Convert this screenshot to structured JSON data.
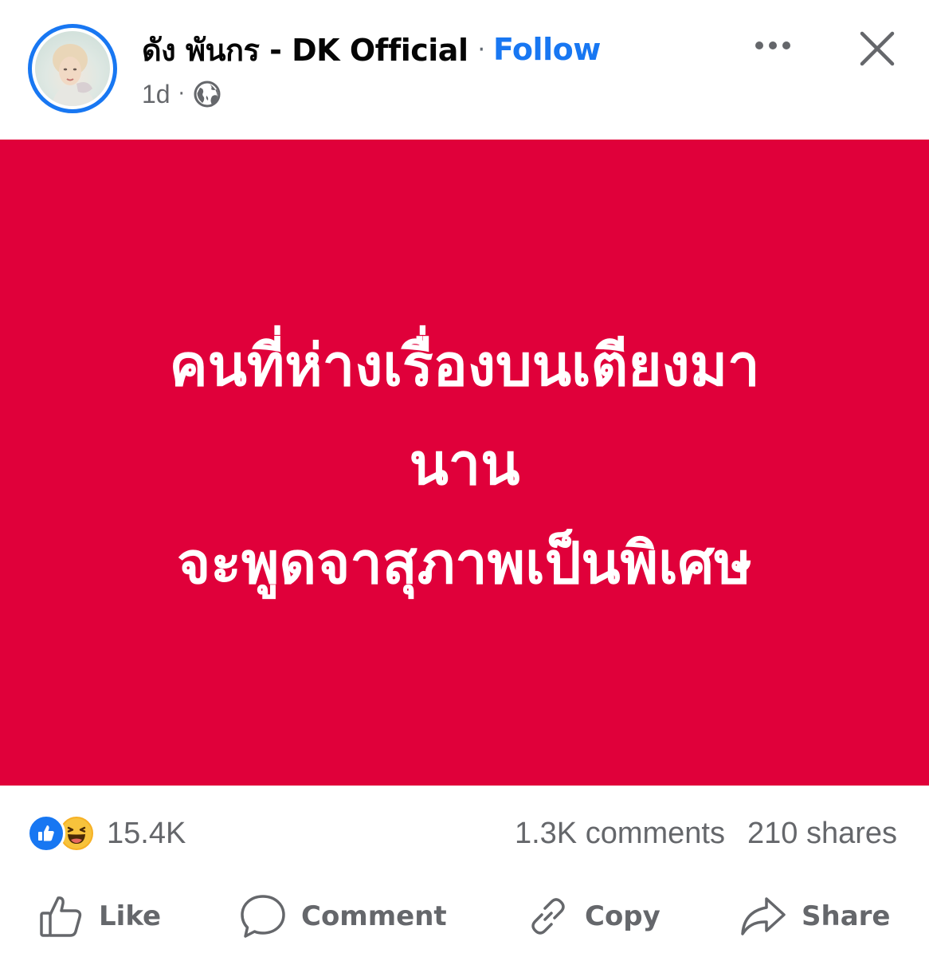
{
  "header": {
    "author_name": "ดัง พันกร - DK Official",
    "separator": "·",
    "follow_label": "Follow",
    "time": "1d",
    "time_separator": "·",
    "privacy_icon": "globe-icon",
    "more_icon": "ellipsis-icon",
    "close_icon": "close-icon"
  },
  "post": {
    "background_color": "#e0003a",
    "text_color": "#ffffff",
    "lines": [
      "คนที่ห่างเรื่องบนเตียงมา",
      "นาน",
      "จะพูดจาสุภาพเป็นพิเศษ"
    ]
  },
  "stats": {
    "reactions": [
      "like",
      "haha"
    ],
    "reaction_count": "15.4K",
    "comments": "1.3K comments",
    "shares": "210 shares"
  },
  "actions": {
    "like_label": "Like",
    "comment_label": "Comment",
    "copy_label": "Copy",
    "share_label": "Share"
  },
  "colors": {
    "accent": "#1877f2",
    "muted_text": "#65676b",
    "post_background": "#e0003a"
  }
}
